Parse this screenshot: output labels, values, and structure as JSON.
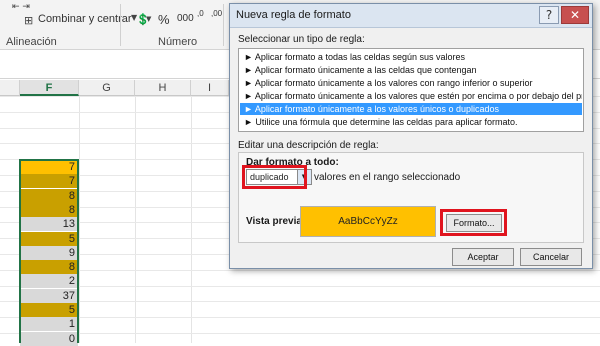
{
  "ribbon": {
    "merge_label": "Combinar y centrar",
    "merge_icon": "merge-cells-icon",
    "dropdown_icon": "chevron-down-icon",
    "percent_glyph": "%",
    "thousands_glyph": "000",
    "dec_glyph": ",0",
    "dec2_glyph": ",00",
    "group_alignment": "Alineación",
    "group_number": "Número"
  },
  "columns": [
    "F",
    "G",
    "H",
    "I"
  ],
  "cells": [
    {
      "value": "7",
      "color": "#ffc000"
    },
    {
      "value": "7",
      "color": "#c9a000"
    },
    {
      "value": "8",
      "color": "#c9a000"
    },
    {
      "value": "8",
      "color": "#c9a000"
    },
    {
      "value": "13",
      "color": "#d9d9d9"
    },
    {
      "value": "5",
      "color": "#c9a000"
    },
    {
      "value": "9",
      "color": "#d9d9d9"
    },
    {
      "value": "8",
      "color": "#c9a000"
    },
    {
      "value": "2",
      "color": "#d9d9d9"
    },
    {
      "value": "37",
      "color": "#d9d9d9"
    },
    {
      "value": "5",
      "color": "#c9a000"
    },
    {
      "value": "1",
      "color": "#d9d9d9"
    },
    {
      "value": "0",
      "color": "#d9d9d9"
    }
  ],
  "dialog": {
    "title": "Nueva regla de formato",
    "select_type_label": "Seleccionar un tipo de regla:",
    "rule_types": [
      "► Aplicar formato a todas las celdas según sus valores",
      "► Aplicar formato únicamente a las celdas que contengan",
      "► Aplicar formato únicamente a los valores con rango inferior o superior",
      "► Aplicar formato únicamente a los valores que estén por encima o por debajo del promedio",
      "► Aplicar formato únicamente a los valores únicos o duplicados",
      "► Utilice una fórmula que determine las celdas para aplicar formato."
    ],
    "selected_rule_index": 4,
    "edit_desc_label": "Editar una descripción de regla:",
    "format_all_label": "Dar formato a todo:",
    "dropdown_value": "duplicado",
    "range_text": "valores en el rango seleccionado",
    "preview_label": "Vista previa:",
    "preview_text": "AaBbCcYyZz",
    "preview_color": "#ffc000",
    "format_button": "Formato...",
    "accept_button": "Aceptar",
    "cancel_button": "Cancelar",
    "help_glyph": "?",
    "close_glyph": "✕"
  },
  "accent_red": "#e0141e",
  "accent_green": "#217346"
}
